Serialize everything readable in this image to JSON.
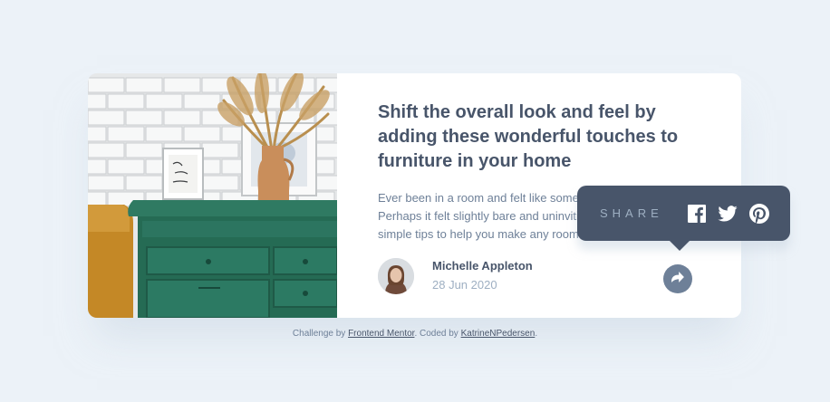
{
  "article": {
    "title": "Shift the overall look and feel by adding these wonderful touches to furniture in your home",
    "excerpt": "Ever been in a room and felt like something was missing? Perhaps it felt slightly bare and uninviting. I’ve got some simple tips to help you make any room feel complete.",
    "author_name": "Michelle Appleton",
    "date": "28 Jun 2020"
  },
  "share": {
    "label": "SHARE",
    "icons": [
      "facebook-icon",
      "twitter-icon",
      "pinterest-icon"
    ],
    "button_icon": "share-arrow-icon"
  },
  "footer": {
    "prefix": "Challenge by ",
    "link1": "Frontend Mentor",
    "middle": ". Coded by ",
    "link2": "KatrineNPedersen",
    "suffix": "."
  },
  "colors": {
    "background": "#ecf2f8",
    "dark_blue": "#48556a",
    "grayish_blue": "#6e8098",
    "light_grayish_blue": "#9eafc2"
  }
}
